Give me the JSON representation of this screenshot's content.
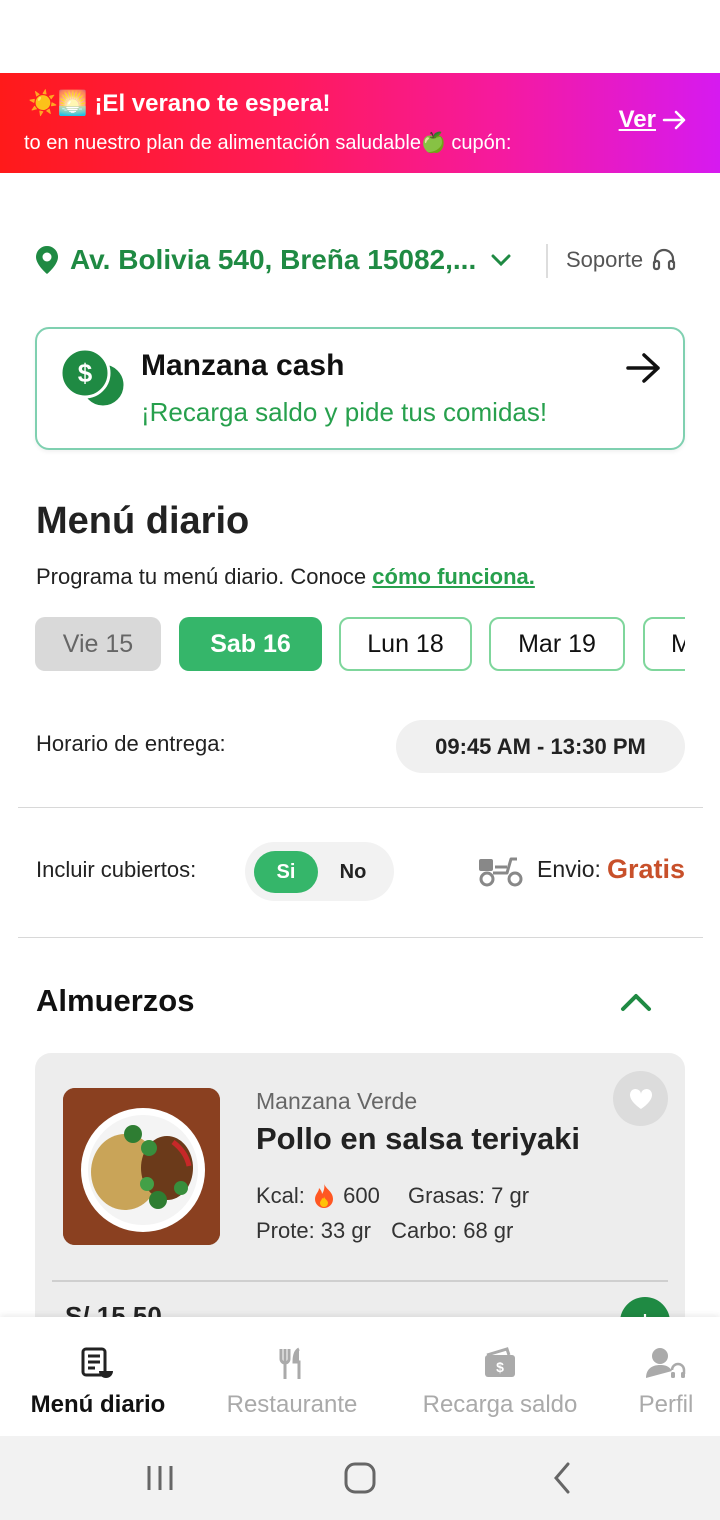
{
  "promo": {
    "emoji": "☀️🌅",
    "title": "¡El verano te espera!",
    "subtitle": "to en nuestro plan de alimentación saludable🍏 cupón:",
    "link": "Ver"
  },
  "address": {
    "text": "Av. Bolivia 540, Breña 15082,...",
    "support": "Soporte"
  },
  "cash_card": {
    "title": "Manzana cash",
    "subtitle": "¡Recarga saldo y pide tus comidas!"
  },
  "menu": {
    "title": "Menú diario",
    "intro": "Programa tu menú diario. Conoce ",
    "intro_link": "cómo funciona."
  },
  "days": [
    {
      "label": "Vie 15",
      "state": "past"
    },
    {
      "label": "Sab 16",
      "state": "selected"
    },
    {
      "label": "Lun 18",
      "state": "open"
    },
    {
      "label": "Mar 19",
      "state": "open"
    },
    {
      "label": "M",
      "state": "open"
    }
  ],
  "delivery": {
    "label": "Horario de entrega:",
    "value": "09:45 AM - 13:30 PM"
  },
  "cutlery": {
    "label": "Incluir cubiertos:",
    "yes": "Si",
    "no": "No",
    "selected": "Si"
  },
  "shipping": {
    "label": "Envio:",
    "value": "Gratis"
  },
  "section": {
    "title": "Almuerzos"
  },
  "dish": {
    "brand": "Manzana Verde",
    "name": "Pollo en salsa teriyaki",
    "kcal_label": "Kcal:",
    "kcal": "600",
    "fat": "Grasas: 7 gr",
    "protein": "Prote: 33 gr",
    "carbs": "Carbo: 68 gr",
    "price": "S/ 15.50"
  },
  "nav": [
    {
      "label": "Menú diario",
      "icon": "menu-list-icon",
      "active": true
    },
    {
      "label": "Restaurante",
      "icon": "fork-knife-icon",
      "active": false
    },
    {
      "label": "Recarga saldo",
      "icon": "wallet-icon",
      "active": false
    },
    {
      "label": "Perfil",
      "icon": "profile-support-icon",
      "active": false
    }
  ],
  "colors": {
    "brand_green": "#1f8a43",
    "accent_green": "#35b66a",
    "shipping_free": "#c8502a"
  }
}
